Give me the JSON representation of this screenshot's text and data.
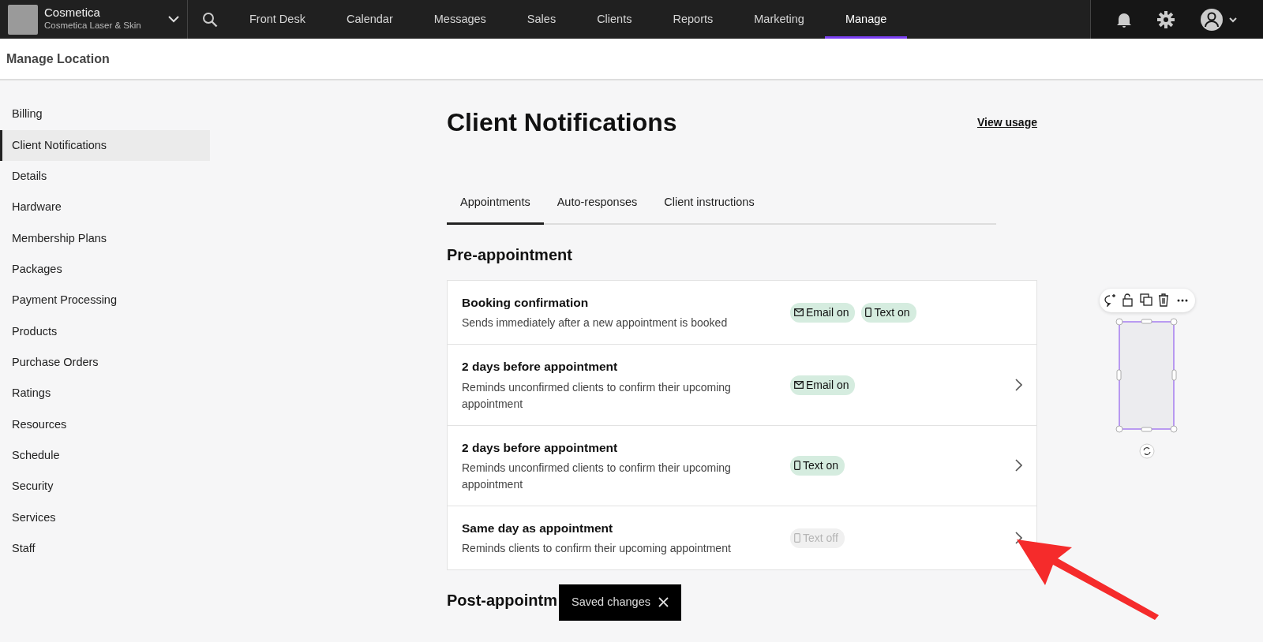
{
  "brand": {
    "name": "Cosmetica",
    "subtitle": "Cosmetica Laser & Skin"
  },
  "nav": [
    {
      "label": "Front Desk",
      "selected": false
    },
    {
      "label": "Calendar",
      "selected": false
    },
    {
      "label": "Messages",
      "selected": false
    },
    {
      "label": "Sales",
      "selected": false
    },
    {
      "label": "Clients",
      "selected": false
    },
    {
      "label": "Reports",
      "selected": false
    },
    {
      "label": "Marketing",
      "selected": false
    },
    {
      "label": "Manage",
      "selected": true
    }
  ],
  "page_title": "Manage Location",
  "sidebar": {
    "items": [
      {
        "label": "Billing",
        "selected": false
      },
      {
        "label": "Client Notifications",
        "selected": true
      },
      {
        "label": "Details",
        "selected": false
      },
      {
        "label": "Hardware",
        "selected": false
      },
      {
        "label": "Membership Plans",
        "selected": false
      },
      {
        "label": "Packages",
        "selected": false
      },
      {
        "label": "Payment Processing",
        "selected": false
      },
      {
        "label": "Products",
        "selected": false
      },
      {
        "label": "Purchase Orders",
        "selected": false
      },
      {
        "label": "Ratings",
        "selected": false
      },
      {
        "label": "Resources",
        "selected": false
      },
      {
        "label": "Schedule",
        "selected": false
      },
      {
        "label": "Security",
        "selected": false
      },
      {
        "label": "Services",
        "selected": false
      },
      {
        "label": "Staff",
        "selected": false
      }
    ]
  },
  "heading": "Client Notifications",
  "view_usage": "View usage",
  "tabs": [
    {
      "label": "Appointments",
      "selected": true
    },
    {
      "label": "Auto-responses",
      "selected": false
    },
    {
      "label": "Client instructions",
      "selected": false
    }
  ],
  "sections": [
    {
      "title": "Pre-appointment",
      "rows": [
        {
          "title": "Booking confirmation",
          "description": "Sends immediately after a new appointment is booked",
          "chevron": false,
          "badges": [
            {
              "kind": "email",
              "label": "Email on",
              "on": true
            },
            {
              "kind": "text",
              "label": "Text on",
              "on": true
            }
          ]
        },
        {
          "title": "2 days before appointment",
          "description": "Reminds unconfirmed clients to confirm their upcoming appointment",
          "chevron": true,
          "badges": [
            {
              "kind": "email",
              "label": "Email on",
              "on": true
            }
          ]
        },
        {
          "title": "2 days before appointment",
          "description": "Reminds unconfirmed clients to confirm their upcoming appointment",
          "chevron": true,
          "badges": [
            {
              "kind": "text",
              "label": "Text on",
              "on": true
            }
          ]
        },
        {
          "title": "Same day as appointment",
          "description": "Reminds clients to confirm their upcoming appointment",
          "chevron": true,
          "badges": [
            {
              "kind": "text",
              "label": "Text off",
              "on": false
            }
          ]
        }
      ]
    },
    {
      "title": "Post-appointm"
    }
  ],
  "toast": {
    "message": "Saved changes"
  }
}
